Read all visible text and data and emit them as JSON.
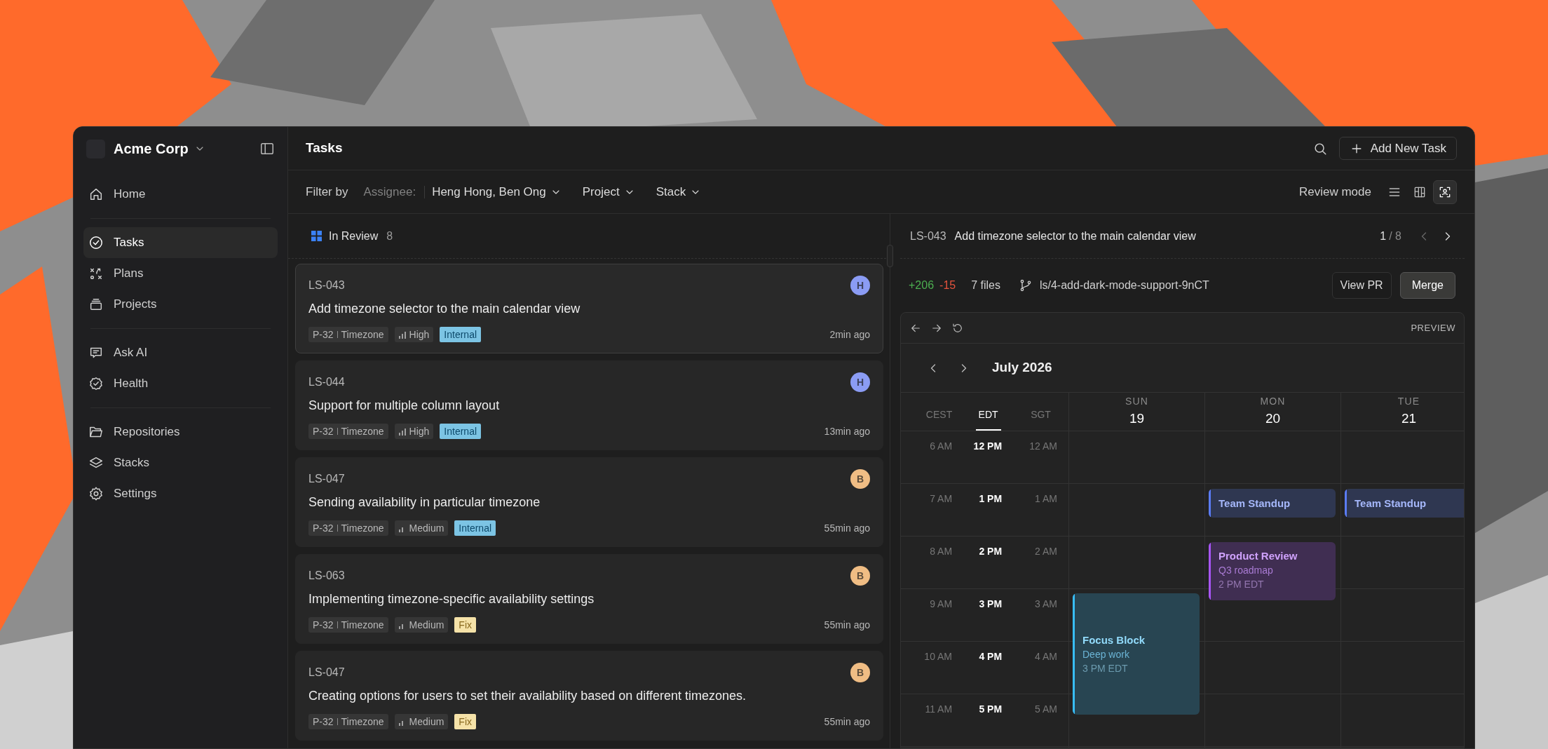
{
  "workspace": {
    "name": "Acme Corp"
  },
  "sidebar": {
    "groups": [
      [
        {
          "label": "Home",
          "selected": false
        }
      ],
      [
        {
          "label": "Tasks",
          "selected": true
        },
        {
          "label": "Plans",
          "selected": false
        },
        {
          "label": "Projects",
          "selected": false
        }
      ],
      [
        {
          "label": "Ask AI",
          "selected": false
        },
        {
          "label": "Health",
          "selected": false
        }
      ],
      [
        {
          "label": "Repositories",
          "selected": false
        },
        {
          "label": "Stacks",
          "selected": false
        },
        {
          "label": "Settings",
          "selected": false
        }
      ]
    ]
  },
  "header": {
    "title": "Tasks",
    "add_button": "Add New Task"
  },
  "filters": {
    "label": "Filter by",
    "assignee_label": "Assignee:",
    "assignee_value": "Heng Hong, Ben Ong",
    "dropdowns": [
      "Project",
      "Stack"
    ]
  },
  "view": {
    "label": "Review mode",
    "modes": [
      {
        "kind": "list",
        "selected": false
      },
      {
        "kind": "board",
        "selected": false
      },
      {
        "kind": "review",
        "selected": true
      }
    ]
  },
  "list": {
    "status": "In Review",
    "count": "8",
    "tasks": [
      {
        "id": "LS-043",
        "title": "Add timezone selector to the main calendar view",
        "selected": true,
        "avatar": {
          "initial": "H",
          "color": "#8b9cf4"
        },
        "project": "P-32",
        "component": "Timezone",
        "priority": {
          "label": "High",
          "kind": "high"
        },
        "type": {
          "label": "Internal",
          "kind": "internal"
        },
        "time": "2min ago"
      },
      {
        "id": "LS-044",
        "title": "Support for multiple column layout",
        "selected": false,
        "avatar": {
          "initial": "H",
          "color": "#8b9cf4"
        },
        "project": "P-32",
        "component": "Timezone",
        "priority": {
          "label": "High",
          "kind": "high"
        },
        "type": {
          "label": "Internal",
          "kind": "internal"
        },
        "time": "13min ago"
      },
      {
        "id": "LS-047",
        "title": "Sending availability in particular timezone",
        "selected": false,
        "avatar": {
          "initial": "B",
          "color": "#f0bd84"
        },
        "project": "P-32",
        "component": "Timezone",
        "priority": {
          "label": "Medium",
          "kind": "medium"
        },
        "type": {
          "label": "Internal",
          "kind": "internal"
        },
        "time": "55min ago"
      },
      {
        "id": "LS-063",
        "title": "Implementing timezone-specific availability settings",
        "selected": false,
        "avatar": {
          "initial": "B",
          "color": "#f0bd84"
        },
        "project": "P-32",
        "component": "Timezone",
        "priority": {
          "label": "Medium",
          "kind": "medium"
        },
        "type": {
          "label": "Fix",
          "kind": "fix"
        },
        "time": "55min ago"
      },
      {
        "id": "LS-047",
        "title": "Creating options for users to set their availability based on different timezones.",
        "selected": false,
        "avatar": {
          "initial": "B",
          "color": "#f0bd84"
        },
        "project": "P-32",
        "component": "Timezone",
        "priority": {
          "label": "Medium",
          "kind": "medium"
        },
        "type": {
          "label": "Fix",
          "kind": "fix"
        },
        "time": "55min ago"
      }
    ]
  },
  "detail": {
    "id": "LS-043",
    "title": "Add timezone selector to the main calendar view",
    "page": "1",
    "page_total": "/ 8",
    "prev_disabled": true,
    "additions": "+206",
    "deletions": "-15",
    "files": "7 files",
    "branch": "ls/4-add-dark-mode-support-9nCT",
    "view_pr": "View PR",
    "merge": "Merge"
  },
  "calendar": {
    "toolbar_label": "PREVIEW",
    "month": "July 2026",
    "timezones": [
      {
        "label": "CEST",
        "selected": false,
        "times": [
          "6 AM",
          "7 AM",
          "8 AM",
          "9 AM",
          "10 AM",
          "11 AM"
        ]
      },
      {
        "label": "EDT",
        "selected": true,
        "times": [
          "12 PM",
          "1 PM",
          "2 PM",
          "3 PM",
          "4 PM",
          "5 PM"
        ]
      },
      {
        "label": "SGT",
        "selected": false,
        "times": [
          "12 AM",
          "1 AM",
          "2 AM",
          "3 AM",
          "4 AM",
          "5 AM"
        ]
      }
    ],
    "days": [
      {
        "weekday": "SUN",
        "date": "19",
        "events": [
          {
            "title": "Focus Block",
            "subtitle": "Deep work",
            "time": "3 PM EDT",
            "color": "#38bdf8"
          }
        ]
      },
      {
        "weekday": "MON",
        "date": "20",
        "events": [
          {
            "title": "Team Standup",
            "color": "#5b7cf6"
          },
          {
            "title": "Product Review",
            "subtitle": "Q3 roadmap",
            "time": "2 PM EDT",
            "color": "#a855f7"
          }
        ]
      },
      {
        "weekday": "TUE",
        "date": "21",
        "events": [
          {
            "title": "Team Standup",
            "color": "#5b7cf6"
          }
        ]
      }
    ]
  }
}
